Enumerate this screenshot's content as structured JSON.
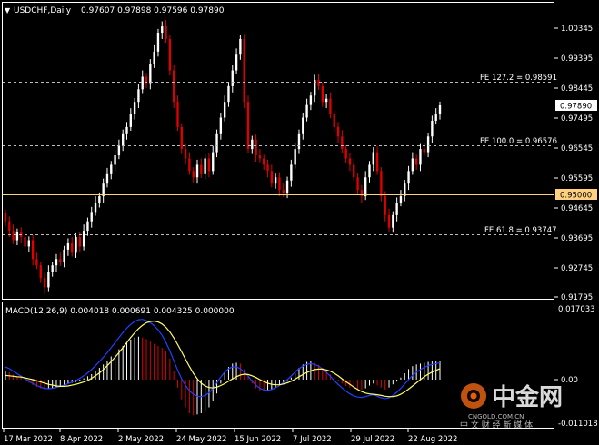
{
  "header": {
    "symbol": "USDCHF,Daily",
    "ohlc": "0.97607 0.97898 0.97596 0.97890",
    "macd_label": "MACD(12,26,9) 0.004018 0.000691 0.004325 0.000000"
  },
  "price_axis": {
    "ticks": [
      "1.00345",
      "0.99395",
      "0.98445",
      "0.97495",
      "0.96545",
      "0.95595",
      "0.94645",
      "0.93695",
      "0.92745",
      "0.91795"
    ],
    "current_price": "0.97890",
    "level_price": "0.95000"
  },
  "macd_axis": {
    "ticks": [
      "0.017033",
      "0.00",
      "-0.011018"
    ]
  },
  "time_axis": {
    "labels": [
      "17 Mar 2022",
      "8 Apr 2022",
      "2 May 2022",
      "24 May 2022",
      "15 Jun 2022",
      "7 Jul 2022",
      "29 Jul 2022",
      "22 Aug 2022"
    ]
  },
  "levels": [
    {
      "label": "FE 127.2 = 0.98591",
      "value": 0.98591
    },
    {
      "label": "FE 100.0 = 0.96576",
      "value": 0.96576
    },
    {
      "label": "FE 61.8 = 0.93747",
      "value": 0.93747
    }
  ],
  "watermark": {
    "logo": "中金网",
    "site": "CNGOLD.COM.CN",
    "tagline": "中 文 财 经 新 媒 体"
  },
  "colors": {
    "bull": "#ffffff",
    "bear": "#e00000",
    "macd_signal": "#ffff66",
    "macd_main": "#2040ff",
    "level_line": "#ffd080",
    "grid": "#bbbbbb"
  },
  "chart_data": {
    "type": "candlestick",
    "symbol": "USDCHF",
    "timeframe": "Daily",
    "ylim": [
      0.9165,
      1.0075
    ],
    "x_labels": [
      "17 Mar 2022",
      "8 Apr 2022",
      "2 May 2022",
      "24 May 2022",
      "15 Jun 2022",
      "7 Jul 2022",
      "29 Jul 2022",
      "22 Aug 2022"
    ],
    "close": [
      0.942,
      0.939,
      0.936,
      0.9385,
      0.937,
      0.934,
      0.936,
      0.93,
      0.928,
      0.924,
      0.921,
      0.926,
      0.928,
      0.93,
      0.929,
      0.933,
      0.935,
      0.932,
      0.937,
      0.934,
      0.939,
      0.942,
      0.945,
      0.948,
      0.95,
      0.954,
      0.957,
      0.96,
      0.963,
      0.966,
      0.97,
      0.972,
      0.976,
      0.98,
      0.984,
      0.988,
      0.986,
      0.992,
      0.996,
      1.002,
      1.004,
      1.0,
      0.99,
      0.98,
      0.972,
      0.965,
      0.962,
      0.958,
      0.956,
      0.96,
      0.957,
      0.962,
      0.958,
      0.964,
      0.97,
      0.975,
      0.98,
      0.985,
      0.99,
      0.995,
      1.0,
      0.98,
      0.965,
      0.968,
      0.963,
      0.962,
      0.96,
      0.958,
      0.954,
      0.956,
      0.952,
      0.951,
      0.955,
      0.96,
      0.965,
      0.97,
      0.975,
      0.979,
      0.982,
      0.987,
      0.985,
      0.98,
      0.981,
      0.976,
      0.972,
      0.969,
      0.965,
      0.962,
      0.96,
      0.956,
      0.952,
      0.95,
      0.956,
      0.96,
      0.964,
      0.958,
      0.95,
      0.944,
      0.94,
      0.944,
      0.948,
      0.95,
      0.954,
      0.958,
      0.962,
      0.96,
      0.965,
      0.964,
      0.969,
      0.974,
      0.976,
      0.9789
    ],
    "macd_series": [
      {
        "name": "MACD histogram",
        "values": [
          0.002,
          0.0018,
          0.0012,
          0.0008,
          0.0005,
          -0.0003,
          -0.0008,
          -0.0014,
          -0.0018,
          -0.0022,
          -0.0025,
          -0.0024,
          -0.0022,
          -0.002,
          -0.0017,
          -0.0014,
          -0.001,
          -0.0008,
          -0.0006,
          -0.0004,
          0.0003,
          0.0008,
          0.0013,
          0.002,
          0.0028,
          0.0036,
          0.0045,
          0.0055,
          0.0064,
          0.0072,
          0.008,
          0.0088,
          0.0095,
          0.01,
          0.0102,
          0.01,
          0.0096,
          0.009,
          0.0085,
          0.008,
          0.0075,
          0.0068,
          0.005,
          0.002,
          -0.002,
          -0.005,
          -0.007,
          -0.0085,
          -0.009,
          -0.0088,
          -0.0085,
          -0.008,
          -0.007,
          -0.0055,
          -0.0035,
          -0.001,
          0.0015,
          0.003,
          0.0038,
          0.004,
          0.0038,
          0.0025,
          0.0008,
          -0.001,
          -0.0022,
          -0.0028,
          -0.003,
          -0.0028,
          -0.0024,
          -0.002,
          -0.0015,
          -0.0012,
          -0.0005,
          0.0005,
          0.0015,
          0.0028,
          0.0036,
          0.0042,
          0.0045,
          0.004,
          0.0035,
          0.0028,
          0.002,
          0.0012,
          0.0005,
          -0.0003,
          -0.001,
          -0.0016,
          -0.002,
          -0.0023,
          -0.0025,
          -0.0026,
          -0.0022,
          -0.0015,
          -0.001,
          -0.0015,
          -0.002,
          -0.0025,
          -0.002,
          -0.0012,
          -0.0005,
          0.0005,
          0.0015,
          0.0025,
          0.0032,
          0.0036,
          0.0038,
          0.004,
          0.0042,
          0.0043,
          0.0043,
          0.0043
        ]
      },
      {
        "name": "MACD main",
        "values": [
          0.003,
          0.0026,
          0.002,
          0.0014,
          0.0008,
          0.0002,
          -0.0004,
          -0.001,
          -0.0015,
          -0.0019,
          -0.0022,
          -0.0023,
          -0.0022,
          -0.002,
          -0.0017,
          -0.0014,
          -0.001,
          -0.0006,
          -0.0002,
          0.0003,
          0.0009,
          0.0016,
          0.0024,
          0.0033,
          0.0043,
          0.0053,
          0.0064,
          0.0076,
          0.0088,
          0.01,
          0.0112,
          0.0122,
          0.0131,
          0.0138,
          0.0142,
          0.0143,
          0.014,
          0.0135,
          0.0128,
          0.0118,
          0.0105,
          0.0088,
          0.0068,
          0.0045,
          0.0022,
          0.0002,
          -0.0015,
          -0.0028,
          -0.0037,
          -0.0042,
          -0.0043,
          -0.004,
          -0.0033,
          -0.0022,
          -0.0008,
          0.0006,
          0.0018,
          0.0026,
          0.003,
          0.003,
          0.0026,
          0.0018,
          0.0008,
          -0.0004,
          -0.0014,
          -0.0022,
          -0.0026,
          -0.0027,
          -0.0025,
          -0.0021,
          -0.0015,
          -0.0008,
          0.0,
          0.0009,
          0.0018,
          0.0026,
          0.0032,
          0.0036,
          0.0038,
          0.0036,
          0.0032,
          0.0025,
          0.0017,
          0.0008,
          -0.0002,
          -0.0012,
          -0.0021,
          -0.0029,
          -0.0036,
          -0.0041,
          -0.0044,
          -0.0045,
          -0.0043,
          -0.004,
          -0.0038,
          -0.0042,
          -0.0046,
          -0.0048,
          -0.0046,
          -0.004,
          -0.0032,
          -0.0022,
          -0.0011,
          0.0,
          0.001,
          0.0018,
          0.0024,
          0.0029,
          0.0033,
          0.0036,
          0.0038,
          0.004
        ]
      },
      {
        "name": "MACD signal",
        "values": [
          0.001,
          0.0009,
          0.0008,
          0.0007,
          0.0006,
          0.0004,
          0.0002,
          0.0,
          -0.0003,
          -0.0006,
          -0.0009,
          -0.0012,
          -0.0014,
          -0.0016,
          -0.0017,
          -0.0017,
          -0.0016,
          -0.0014,
          -0.0012,
          -0.0009,
          -0.0006,
          -0.0002,
          0.0003,
          0.0009,
          0.0016,
          0.0024,
          0.0033,
          0.0043,
          0.0053,
          0.0064,
          0.0076,
          0.0088,
          0.01,
          0.0111,
          0.0121,
          0.0129,
          0.0135,
          0.0138,
          0.0139,
          0.0137,
          0.0132,
          0.0124,
          0.0113,
          0.0099,
          0.0083,
          0.0066,
          0.0048,
          0.0031,
          0.0015,
          0.0002,
          -0.0009,
          -0.0016,
          -0.002,
          -0.0021,
          -0.0019,
          -0.0015,
          -0.001,
          -0.0004,
          0.0002,
          0.0007,
          0.0011,
          0.0013,
          0.0012,
          0.0009,
          0.0005,
          0.0,
          -0.0005,
          -0.0009,
          -0.0012,
          -0.0013,
          -0.0013,
          -0.0011,
          -0.0008,
          -0.0004,
          0.0001,
          0.0007,
          0.0012,
          0.0017,
          0.0021,
          0.0024,
          0.0025,
          0.0025,
          0.0023,
          0.002,
          0.0015,
          0.0009,
          0.0002,
          -0.0005,
          -0.0012,
          -0.0019,
          -0.0025,
          -0.003,
          -0.0034,
          -0.0036,
          -0.0037,
          -0.0038,
          -0.004,
          -0.0042,
          -0.0043,
          -0.0043,
          -0.0041,
          -0.0037,
          -0.0031,
          -0.0024,
          -0.0016,
          -0.0008,
          0.0,
          0.0007,
          0.0013,
          0.0018,
          0.0022,
          0.0026
        ]
      }
    ],
    "macd_ylim": [
      -0.011018,
      0.017033
    ]
  }
}
